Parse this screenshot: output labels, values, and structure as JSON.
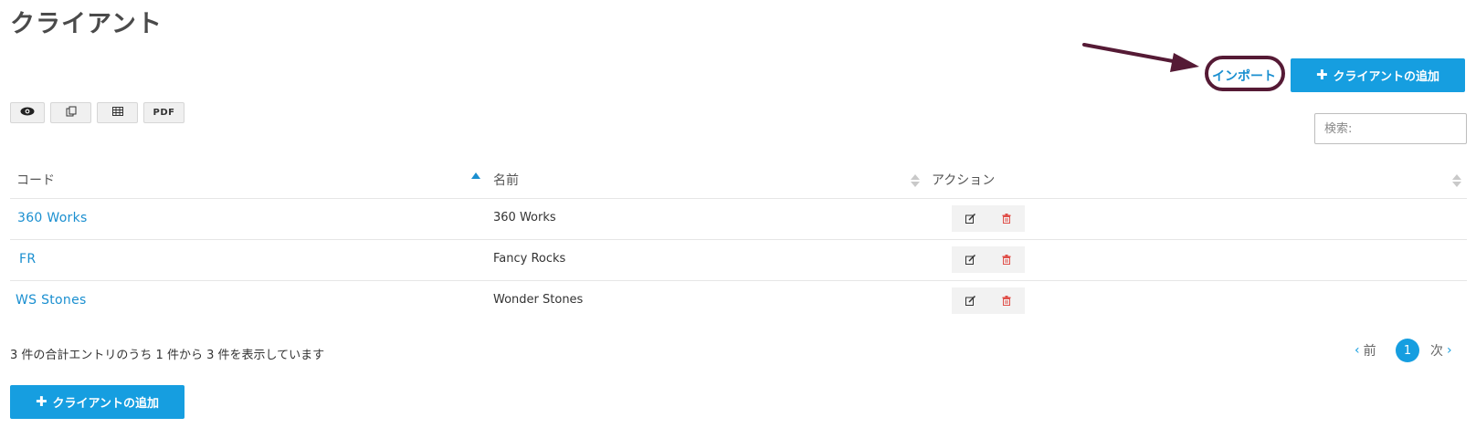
{
  "page": {
    "title": "クライアント"
  },
  "toolbar": {
    "import_label": "インポート",
    "add_client_label": "クライアントの追加",
    "export_buttons": [
      {
        "icon": "eye-icon"
      },
      {
        "icon": "copy-icon"
      },
      {
        "icon": "table-icon"
      },
      {
        "label": "PDF"
      }
    ]
  },
  "search": {
    "placeholder": "検索:"
  },
  "table": {
    "headers": {
      "code": "コード",
      "name": "名前",
      "actions": "アクション"
    },
    "sorted_column": "code",
    "rows": [
      {
        "code": "360 Works",
        "name": "360 Works"
      },
      {
        "code": "FR",
        "name": "Fancy Rocks"
      },
      {
        "code": "WS Stones",
        "name": "Wonder Stones"
      }
    ]
  },
  "footer": {
    "info": "3 件の合計エントリのうち 1 件から 3 件を表示しています",
    "prev_label": "前",
    "current_page": "1",
    "next_label": "次",
    "add_client_label": "クライアントの追加"
  },
  "colors": {
    "accent": "#169ee0",
    "link": "#1a8fd0",
    "annotation": "#551a35",
    "delete": "#e0504a"
  }
}
